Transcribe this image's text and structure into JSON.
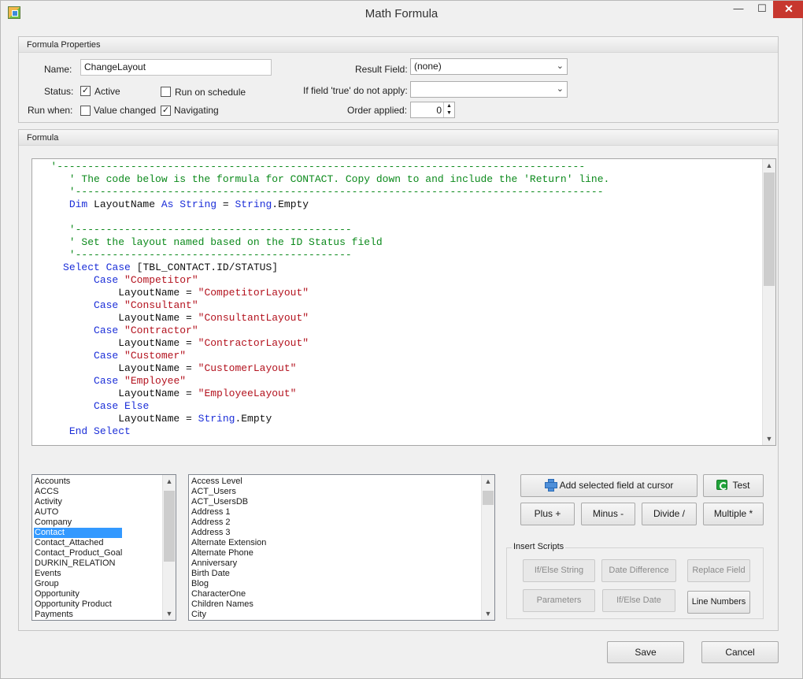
{
  "window": {
    "title": "Math Formula",
    "minimize_glyph": "—",
    "maximize_glyph": "☐",
    "close_glyph": "✕"
  },
  "properties": {
    "header": "Formula Properties",
    "name_label": "Name:",
    "name_value": "ChangeLayout",
    "status_label": "Status:",
    "active_label": "Active",
    "active_checked": true,
    "run_on_schedule_label": "Run on schedule",
    "run_on_schedule_checked": false,
    "run_when_label": "Run when:",
    "value_changed_label": "Value changed",
    "value_changed_checked": false,
    "navigating_label": "Navigating",
    "navigating_checked": true,
    "result_field_label": "Result Field:",
    "result_field_value": "(none)",
    "if_true_label": "If field 'true' do not apply:",
    "if_true_value": "",
    "order_label": "Order applied:",
    "order_value": "0"
  },
  "formula": {
    "header": "Formula",
    "code_lines": [
      "   '--------------------------------------------------------------------------------------",
      "      ' The code below is the formula for CONTACT. Copy down to and include the 'Return' line.",
      "      '--------------------------------------------------------------------------------------",
      "      Dim LayoutName As String = String.Empty",
      "",
      "      '---------------------------------------------",
      "      ' Set the layout named based on the ID Status field",
      "      '---------------------------------------------",
      "     Select Case [TBL_CONTACT.ID/STATUS]",
      "          Case \"Competitor\"",
      "              LayoutName = \"CompetitorLayout\"",
      "          Case \"Consultant\"",
      "              LayoutName = \"ConsultantLayout\"",
      "          Case \"Contractor\"",
      "              LayoutName = \"ContractorLayout\"",
      "          Case \"Customer\"",
      "              LayoutName = \"CustomerLayout\"",
      "          Case \"Employee\"",
      "              LayoutName = \"EmployeeLayout\"",
      "          Case Else",
      "              LayoutName = String.Empty",
      "      End Select"
    ]
  },
  "tables_list": {
    "items": [
      "Accounts",
      "ACCS",
      "Activity",
      "AUTO",
      "Company",
      "Contact",
      "Contact_Attached",
      "Contact_Product_Goal",
      "DURKIN_RELATION",
      "Events",
      "Group",
      "Opportunity",
      "Opportunity Product",
      "Payments"
    ],
    "selected": "Contact"
  },
  "fields_list": {
    "items": [
      "Access Level",
      "ACT_Users",
      "ACT_UsersDB",
      "Address 1",
      "Address 2",
      "Address 3",
      "Alternate Extension",
      "Alternate Phone",
      "Anniversary",
      "Birth Date",
      "Blog",
      "CharacterOne",
      "Children Names",
      "City"
    ]
  },
  "actions": {
    "add_field_label": "Add selected field at cursor",
    "test_label": "Test",
    "plus_label": "Plus +",
    "minus_label": "Minus -",
    "divide_label": "Divide /",
    "multiple_label": "Multiple *"
  },
  "insert_scripts": {
    "label": "Insert Scripts",
    "if_else_string": "If/Else String",
    "date_difference": "Date Difference",
    "replace_field": "Replace Field",
    "parameters": "Parameters",
    "if_else_date": "If/Else Date",
    "line_numbers": "Line Numbers"
  },
  "footer": {
    "save_label": "Save",
    "cancel_label": "Cancel"
  },
  "colors": {
    "comment": "#0c8a1c",
    "keyword": "#1b2ed8",
    "string": "#b3121e",
    "selection": "#3399ff"
  }
}
